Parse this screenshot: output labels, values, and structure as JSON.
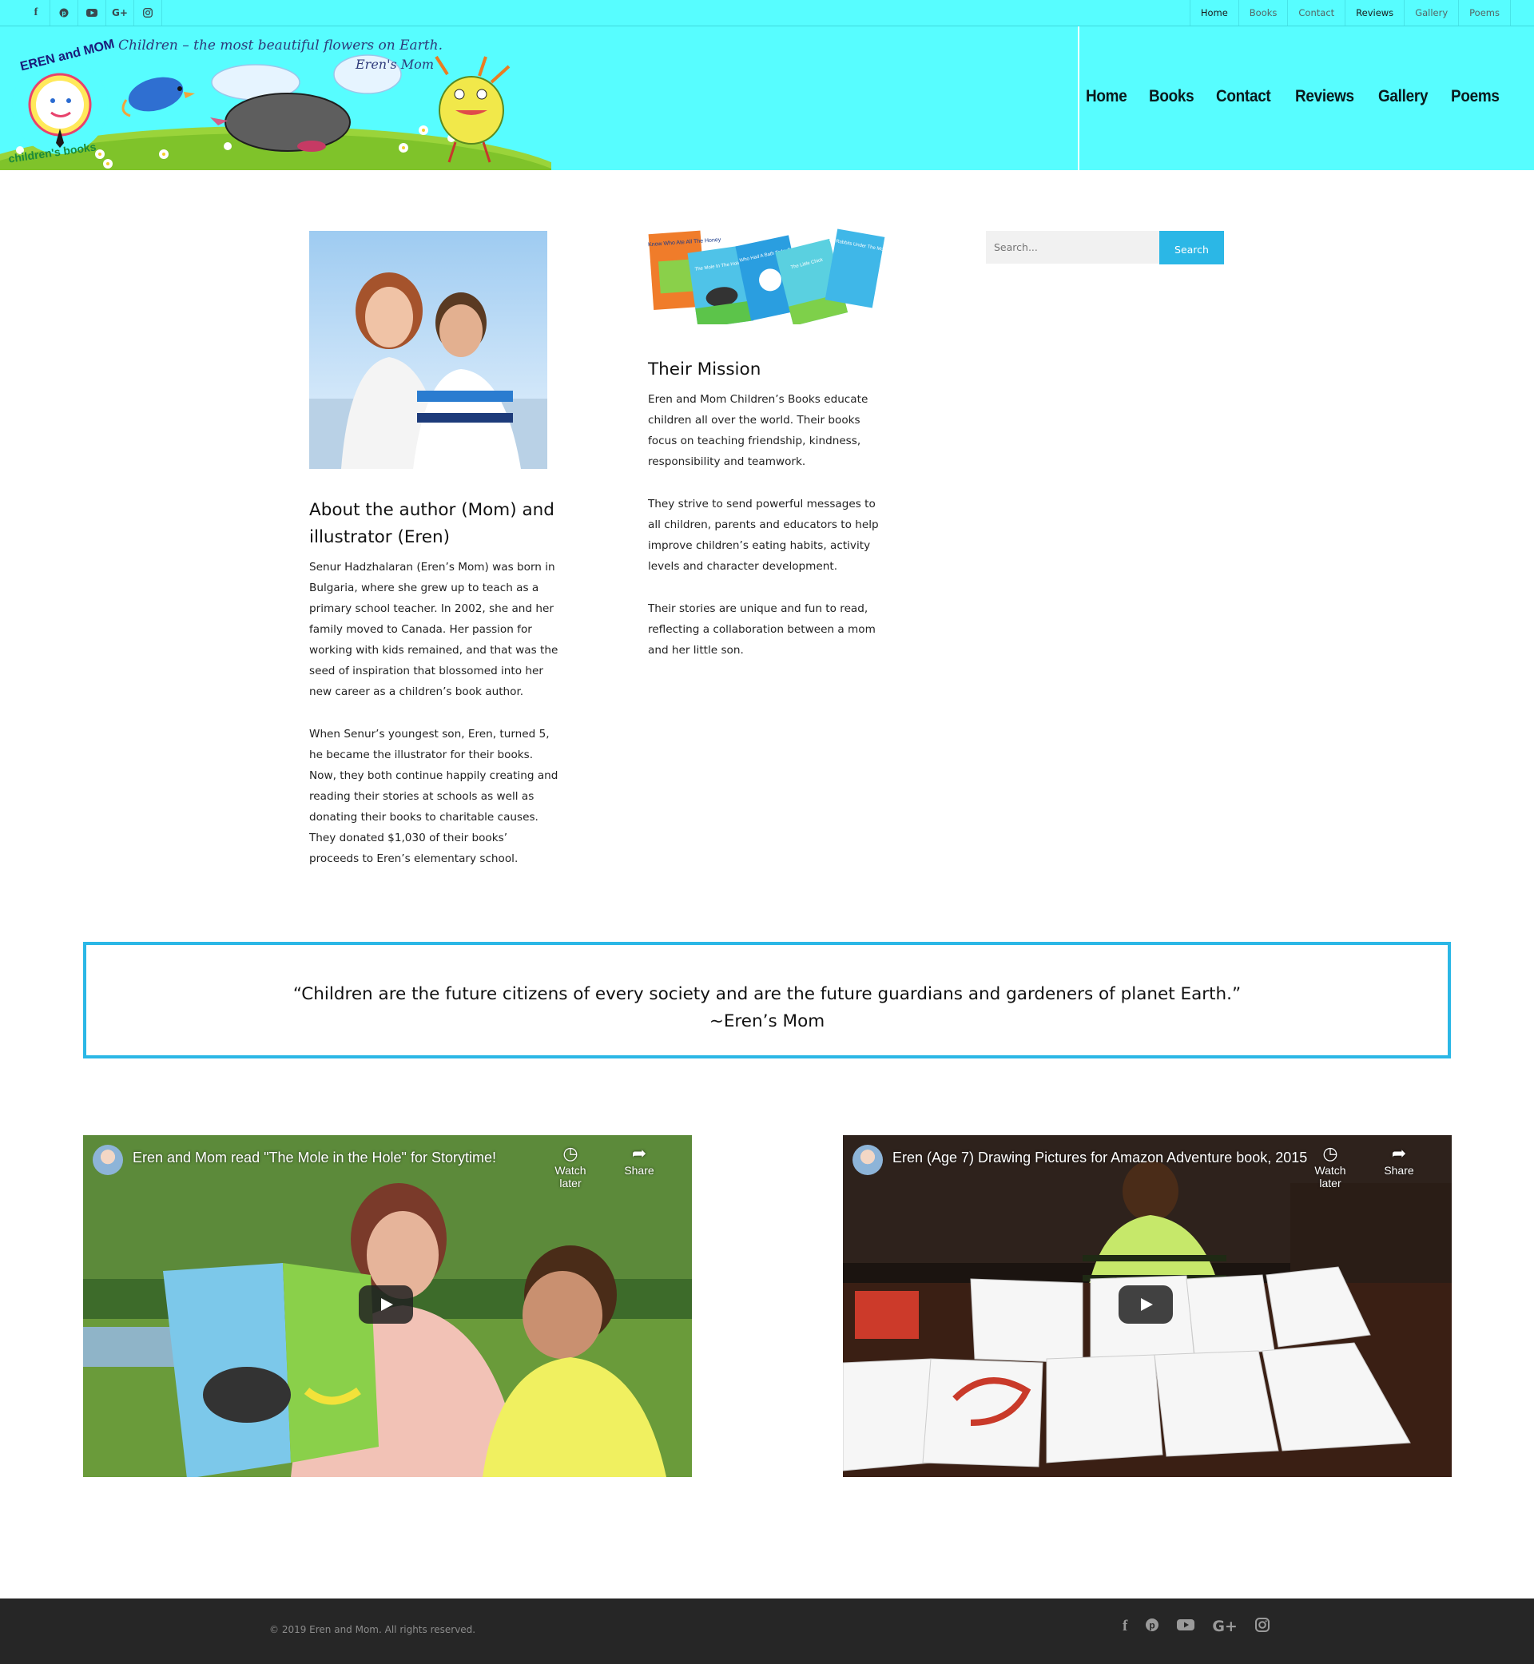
{
  "topbar": {
    "social_icons": [
      "facebook-icon",
      "pinterest-icon",
      "youtube-icon",
      "google-plus-icon",
      "instagram-icon"
    ],
    "nav": [
      "Home",
      "Books",
      "Contact",
      "Reviews",
      "Gallery",
      "Poems"
    ]
  },
  "header": {
    "logo_line1": "EREN and MOM",
    "logo_line2": "children's books",
    "tagline": "Children – the most beautiful flowers on Earth.",
    "tagline_author": "Eren's Mom",
    "nav": [
      "Home",
      "Books",
      "Contact",
      "Reviews",
      "Gallery",
      "Poems"
    ]
  },
  "author": {
    "title": "About the author (Mom) and illustrator (Eren)",
    "p1": "Senur Hadzhalaran (Eren’s Mom) was born in Bulgaria, where she grew up to teach as a primary school teacher. In 2002, she and her family moved to Canada. Her passion for working with kids remained, and that was the seed of inspiration that blossomed into her new career as a children’s book author.",
    "p2": "When Senur’s youngest son, Eren, turned 5, he became the illustrator for their books. Now, they both continue happily creating and reading their stories at schools as well as donating their books to charitable causes. They donated $1,030 of their books’ proceeds to Eren’s elementary school."
  },
  "mission": {
    "book_covers": [
      "Do You Know Who Ate All The Honey",
      "The Mole In The Hole",
      "Who Had A Bath Today?",
      "The Little Chick",
      "21 Rabbits Under The Moon"
    ],
    "title": "Their Mission",
    "p1": "Eren and Mom Children’s Books educate children all over the world. Their books focus on teaching friendship, kindness, responsibility and teamwork.",
    "p2": "They strive to send powerful messages to all children, parents and educators to help improve children’s eating habits, activity levels and character development.",
    "p3": "Their stories are unique and fun to read, reflecting a collaboration between a mom and her little son."
  },
  "search": {
    "placeholder": "Search...",
    "button": "Search"
  },
  "quote": {
    "text": "“Children are the future citizens of every society and are the future guardians and gardeners of planet Earth.”",
    "attribution": "~Eren’s Mom"
  },
  "videos": [
    {
      "title": "Eren and Mom read \"The Mole in the Hole\" for Storytime!",
      "watch_later": "Watch later",
      "share": "Share"
    },
    {
      "title": "Eren (Age 7) Drawing Pictures for Amazon Adventure book, 2015",
      "watch_later": "Watch later",
      "share": "Share"
    }
  ],
  "footer": {
    "copyright": "© 2019 Eren and Mom. All rights reserved.",
    "social_icons": [
      "facebook-icon",
      "pinterest-icon",
      "youtube-icon",
      "google-plus-icon",
      "instagram-icon"
    ]
  },
  "colors": {
    "topbar_bg": "#57fdff",
    "accent": "#2bb7e6",
    "footer_bg": "#262626"
  }
}
